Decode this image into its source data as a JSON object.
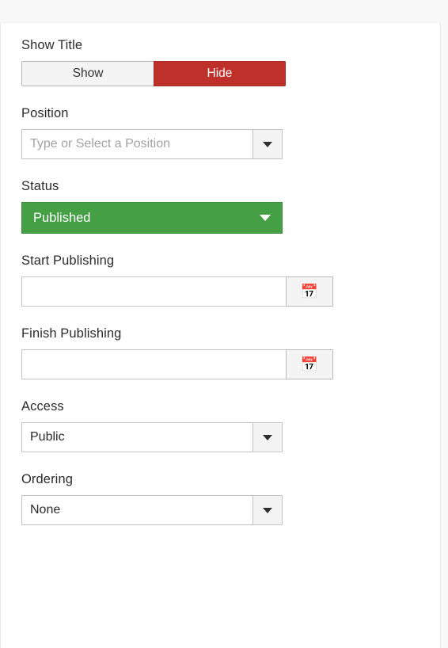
{
  "form": {
    "fields": [
      {
        "key": "show_title",
        "label": "Show Title",
        "type": "button-group",
        "options": [
          "Show",
          "Hide"
        ],
        "selected": "Hide",
        "selected_color": "#c0302b"
      },
      {
        "key": "position",
        "label": "Position",
        "type": "combobox",
        "value": "",
        "placeholder": "Type or Select a Position",
        "caret_icon": "chevron-down-icon"
      },
      {
        "key": "status",
        "label": "Status",
        "type": "select",
        "value": "Published",
        "accent_color": "#45a045",
        "caret_icon": "chevron-down-icon"
      },
      {
        "key": "start_publishing",
        "label": "Start Publishing",
        "type": "date",
        "value": "",
        "button_icon": "calendar-icon"
      },
      {
        "key": "finish_publishing",
        "label": "Finish Publishing",
        "type": "date",
        "value": "",
        "button_icon": "calendar-icon"
      },
      {
        "key": "access",
        "label": "Access",
        "type": "select",
        "value": "Public",
        "caret_icon": "chevron-down-icon"
      },
      {
        "key": "ordering",
        "label": "Ordering",
        "type": "select",
        "value": "None",
        "caret_icon": "chevron-down-icon"
      }
    ]
  },
  "icons": {
    "calendar": "📅"
  }
}
